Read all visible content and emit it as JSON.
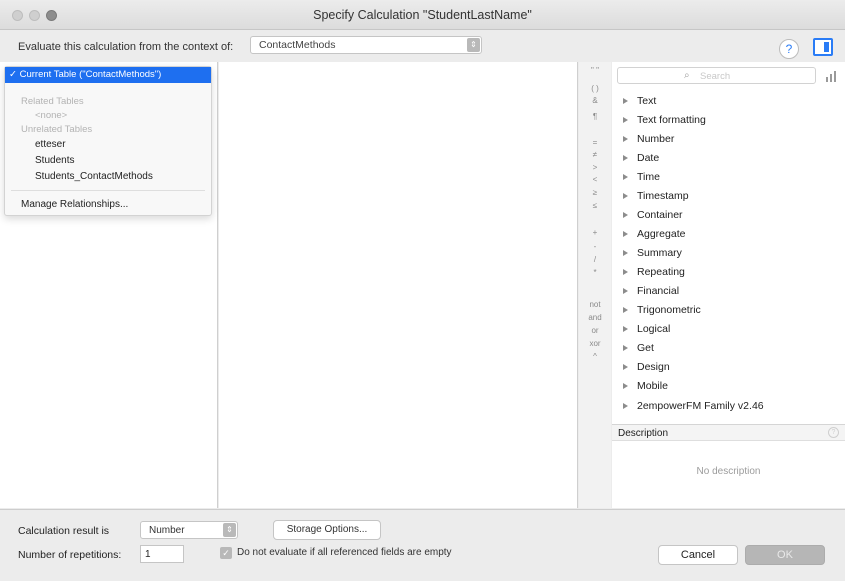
{
  "window": {
    "title": "Specify Calculation \"StudentLastName\""
  },
  "context": {
    "label": "Evaluate this calculation from the context of:",
    "value": "ContactMethods"
  },
  "toolbar": {
    "help_label": "?"
  },
  "context_menu": {
    "selected": "✓ Current Table (\"ContactMethods\")",
    "related_header": "Related Tables",
    "related_none": "<none>",
    "unrelated_header": "Unrelated Tables",
    "unrelated_items": [
      "etteser",
      "Students",
      "Students_ContactMethods"
    ],
    "manage": "Manage Relationships..."
  },
  "operators": [
    "\" \"",
    "( )",
    "&",
    "¶",
    "=",
    "≠",
    ">",
    "<",
    "≥",
    "≤",
    "+",
    "-",
    "/",
    "*",
    "not",
    "and",
    "or",
    "xor",
    "^"
  ],
  "functions": {
    "search_placeholder": "Search",
    "categories": [
      "Text",
      "Text formatting",
      "Number",
      "Date",
      "Time",
      "Timestamp",
      "Container",
      "Aggregate",
      "Summary",
      "Repeating",
      "Financial",
      "Trigonometric",
      "Logical",
      "Get",
      "Design",
      "Mobile",
      "2empowerFM Family v2.46"
    ]
  },
  "description": {
    "header": "Description",
    "empty_text": "No description"
  },
  "bottom": {
    "result_label": "Calculation result is",
    "result_value": "Number",
    "storage_label": "Storage Options...",
    "reps_label": "Number of repetitions:",
    "reps_value": "1",
    "checkbox_label": "Do not evaluate if all referenced fields are empty",
    "cancel_label": "Cancel",
    "ok_label": "OK"
  },
  "colors": {
    "accent": "#1e6ff0",
    "help_blue": "#2a7cf6"
  },
  "icons": [
    "close-icon",
    "minimize-icon",
    "zoom-icon",
    "search-icon",
    "sort-icon",
    "disclosure-triangle-icon",
    "help-icon",
    "panel-toggle-icon",
    "checkbox-icon",
    "stepper-icon"
  ]
}
